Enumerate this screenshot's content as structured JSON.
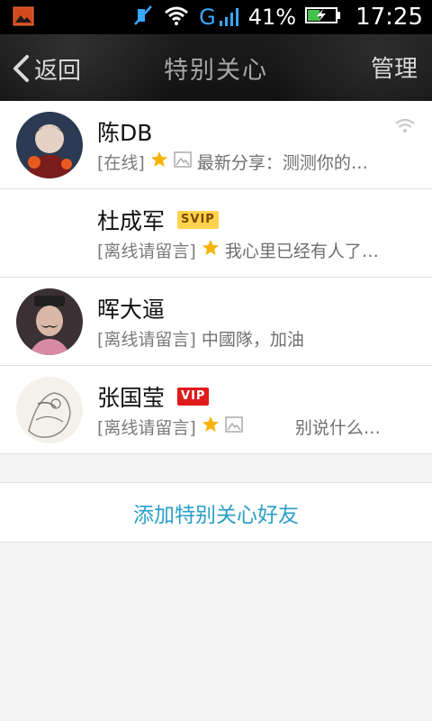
{
  "status_bar": {
    "battery": "41%",
    "network": "G",
    "time": "17:25",
    "icons": [
      "gallery-icon",
      "mute-icon",
      "wifi-icon",
      "signal-icon",
      "battery-icon"
    ]
  },
  "header": {
    "back_label": "返回",
    "title": "特别关心",
    "manage_label": "管理"
  },
  "contacts": [
    {
      "name": "陈DB",
      "status": "[在线]",
      "message": "最新分享：测测你的…",
      "badge": "",
      "has_star": true,
      "has_image_icon": true,
      "has_wifi_icon": true
    },
    {
      "name": "杜成军",
      "status": "[离线请留言]",
      "message": "我心里已经有人了…",
      "badge": "SVIP",
      "has_star": true,
      "has_image_icon": false,
      "has_wifi_icon": false
    },
    {
      "name": "晖大逼",
      "status": "[离线请留言]",
      "message": "中國隊，加油",
      "badge": "",
      "has_star": false,
      "has_image_icon": false,
      "has_wifi_icon": false
    },
    {
      "name": "张国莹",
      "status": "[离线请留言]",
      "message": "别说什么…",
      "badge": "VIP",
      "has_star": true,
      "has_image_icon": true,
      "has_wifi_icon": false
    }
  ],
  "add_button_label": "添加特别关心好友",
  "colors": {
    "accent": "#2a9fc7",
    "svip_badge": "#ffd34d",
    "vip_badge": "#e01b1b",
    "star": "#f6b400"
  }
}
